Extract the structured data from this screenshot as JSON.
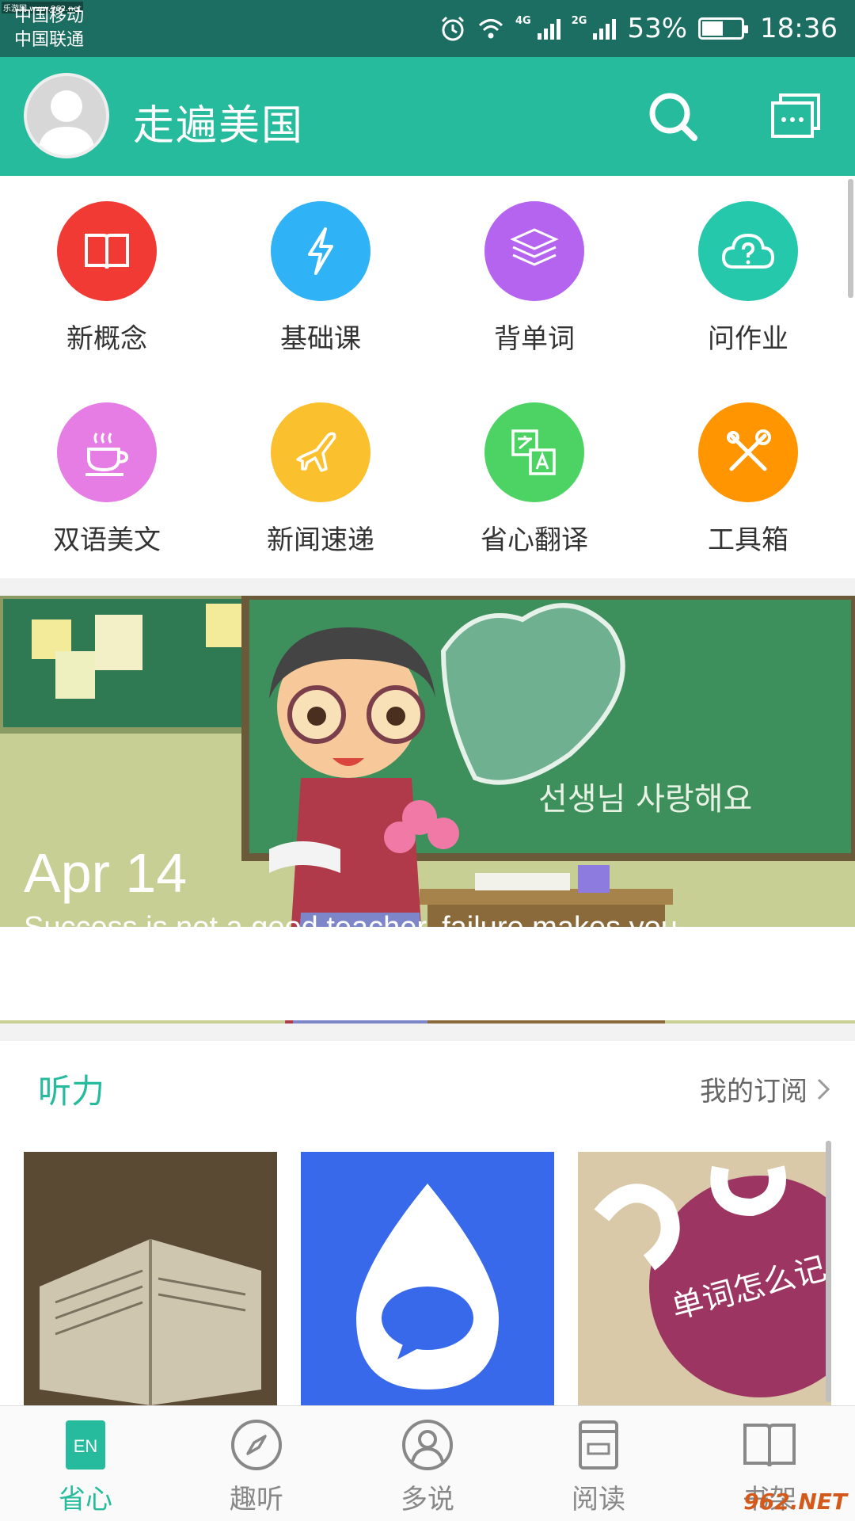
{
  "status": {
    "carrier1": "中国移动",
    "carrier2": "中国联通",
    "net1": "4G",
    "net2": "2G",
    "battery": "53%",
    "time": "18:36",
    "corner_text": "乐游网 www.962.net"
  },
  "header": {
    "title": "走遍美国"
  },
  "grid": [
    {
      "label": "新概念",
      "color": "#f03a33",
      "icon": "book-icon"
    },
    {
      "label": "基础课",
      "color": "#2fb2f6",
      "icon": "lightning-icon"
    },
    {
      "label": "背单词",
      "color": "#b464ee",
      "icon": "word-layers-icon"
    },
    {
      "label": "问作业",
      "color": "#25c8ab",
      "icon": "question-cloud-icon"
    },
    {
      "label": "双语美文",
      "color": "#e57de5",
      "icon": "coffee-cup-icon"
    },
    {
      "label": "新闻速递",
      "color": "#fbc02d",
      "icon": "airplane-icon"
    },
    {
      "label": "省心翻译",
      "color": "#4cd364",
      "icon": "translate-icon"
    },
    {
      "label": "工具箱",
      "color": "#ff9500",
      "icon": "tools-icon"
    }
  ],
  "banner": {
    "date": "Apr 14",
    "quote": "Success is not a good teacher, failure makes you",
    "board_text": "선생님 사랑해요"
  },
  "section": {
    "title": "听力",
    "more": "我的订阅"
  },
  "cards": [
    {
      "image": "open-book-photo"
    },
    {
      "image": "drop-chat-logo"
    },
    {
      "image": "word-memory-cover",
      "text": "单词怎么记"
    }
  ],
  "bottom_nav": [
    {
      "label": "省心",
      "icon": "en-icon",
      "active": true,
      "badge": "EN"
    },
    {
      "label": "趣听",
      "icon": "compass-icon",
      "active": false
    },
    {
      "label": "多说",
      "icon": "person-icon",
      "active": false
    },
    {
      "label": "阅读",
      "icon": "reader-icon",
      "active": false
    },
    {
      "label": "书架",
      "icon": "open-book-icon",
      "active": false
    }
  ],
  "watermark": "962.NET"
}
